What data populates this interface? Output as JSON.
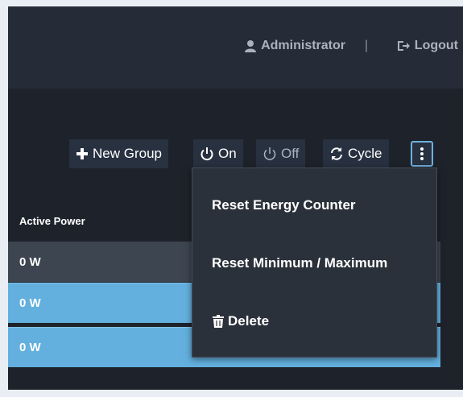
{
  "header": {
    "user_label": "Administrator",
    "separator": "|",
    "logout_label": "Logout"
  },
  "toolbar": {
    "new_group_label": "New Group",
    "on_label": "On",
    "off_label": "Off",
    "cycle_label": "Cycle"
  },
  "table": {
    "columns": [
      "Active Power"
    ],
    "rows": [
      {
        "active_power": "0 W"
      },
      {
        "active_power": "0 W"
      },
      {
        "active_power": "0 W"
      }
    ]
  },
  "menu": {
    "items": [
      {
        "label": "Reset Energy Counter"
      },
      {
        "label": "Reset Minimum / Maximum"
      },
      {
        "label": "Delete",
        "icon": "trash-icon"
      }
    ]
  },
  "colors": {
    "topbar": "#252c37",
    "background": "#1e232b",
    "selected_row": "#63b0df",
    "menu_bg": "#2b313a",
    "accent_border": "#6fb1e0"
  }
}
